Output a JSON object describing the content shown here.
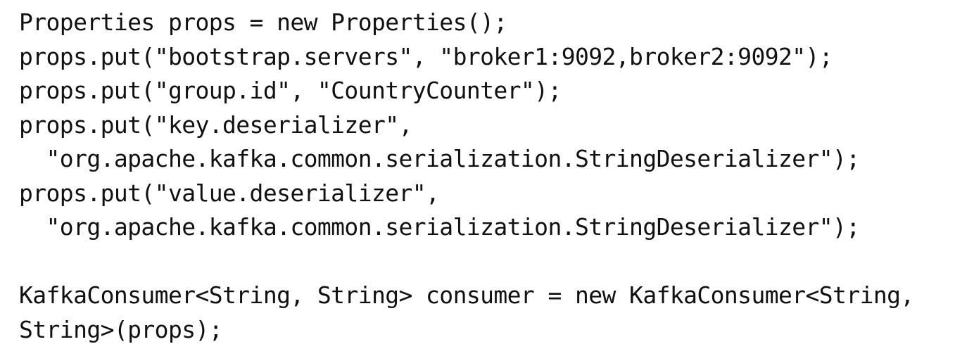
{
  "code": {
    "lines": [
      "Properties props = new Properties();",
      "props.put(\"bootstrap.servers\", \"broker1:9092,broker2:9092\");",
      "props.put(\"group.id\", \"CountryCounter\");",
      "props.put(\"key.deserializer\",",
      "  \"org.apache.kafka.common.serialization.StringDeserializer\");",
      "props.put(\"value.deserializer\",",
      "  \"org.apache.kafka.common.serialization.StringDeserializer\");",
      "",
      "KafkaConsumer<String, String> consumer = new KafkaConsumer<String,",
      "String>(props);"
    ]
  }
}
